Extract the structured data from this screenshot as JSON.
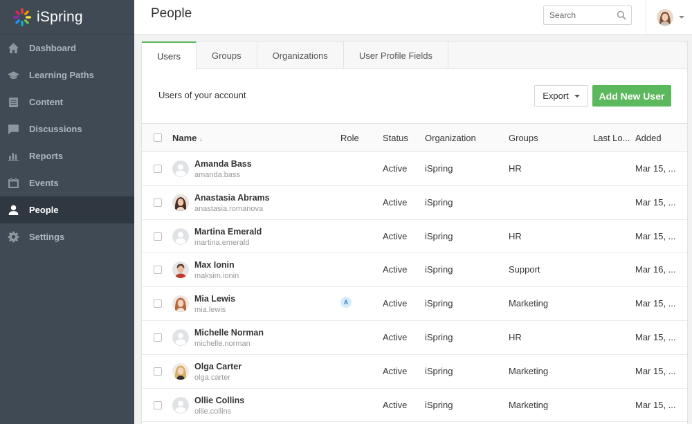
{
  "app": {
    "logo_text": "iSpring"
  },
  "sidebar": {
    "items": [
      {
        "label": "Dashboard",
        "icon": "home-icon",
        "active": false
      },
      {
        "label": "Learning Paths",
        "icon": "graduation-cap-icon",
        "active": false
      },
      {
        "label": "Content",
        "icon": "document-icon",
        "active": false
      },
      {
        "label": "Discussions",
        "icon": "chat-icon",
        "active": false
      },
      {
        "label": "Reports",
        "icon": "bar-chart-icon",
        "active": false
      },
      {
        "label": "Events",
        "icon": "calendar-icon",
        "active": false
      },
      {
        "label": "People",
        "icon": "person-icon",
        "active": true
      },
      {
        "label": "Settings",
        "icon": "gear-icon",
        "active": false
      }
    ]
  },
  "header": {
    "title": "People",
    "search_placeholder": "Search"
  },
  "tabs": [
    {
      "label": "Users",
      "active": true
    },
    {
      "label": "Groups",
      "active": false
    },
    {
      "label": "Organizations",
      "active": false
    },
    {
      "label": "User Profile Fields",
      "active": false
    }
  ],
  "toolbar": {
    "subtitle": "Users of your account",
    "export_label": "Export",
    "add_label": "Add New User"
  },
  "table": {
    "columns": {
      "name": "Name",
      "sort_icon": "↓",
      "role": "Role",
      "status": "Status",
      "organization": "Organization",
      "groups": "Groups",
      "last_login": "Last Lo...",
      "added": "Added"
    },
    "rows": [
      {
        "name": "Amanda Bass",
        "login": "amanda.bass",
        "role": "",
        "status": "Active",
        "organization": "iSpring",
        "groups": "HR",
        "last_login": "",
        "added": "Mar 15, ...",
        "avatar": "placeholder"
      },
      {
        "name": "Anastasia Abrams",
        "login": "anastasia.romanova",
        "role": "",
        "status": "Active",
        "organization": "iSpring",
        "groups": "",
        "last_login": "",
        "added": "Mar 15, ...",
        "avatar": "photo-brunette"
      },
      {
        "name": "Martina Emerald",
        "login": "martina.emerald",
        "role": "",
        "status": "Active",
        "organization": "iSpring",
        "groups": "HR",
        "last_login": "",
        "added": "Mar 15, ...",
        "avatar": "placeholder"
      },
      {
        "name": "Max Ionin",
        "login": "maksim.ionin",
        "role": "",
        "status": "Active",
        "organization": "iSpring",
        "groups": "Support",
        "last_login": "",
        "added": "Mar 16, ...",
        "avatar": "photo-man"
      },
      {
        "name": "Mia Lewis",
        "login": "mia.lewis",
        "role": "A",
        "status": "Active",
        "organization": "iSpring",
        "groups": "Marketing",
        "last_login": "",
        "added": "Mar 15, ...",
        "avatar": "photo-redhead"
      },
      {
        "name": "Michelle Norman",
        "login": "michelle.norman",
        "role": "",
        "status": "Active",
        "organization": "iSpring",
        "groups": "HR",
        "last_login": "",
        "added": "Mar 15, ...",
        "avatar": "placeholder"
      },
      {
        "name": "Olga Carter",
        "login": "olga.carter",
        "role": "",
        "status": "Active",
        "organization": "iSpring",
        "groups": "Marketing",
        "last_login": "",
        "added": "Mar 15, ...",
        "avatar": "photo-blonde"
      },
      {
        "name": "Ollie Collins",
        "login": "ollie.collins",
        "role": "",
        "status": "Active",
        "organization": "iSpring",
        "groups": "Marketing",
        "last_login": "",
        "added": "Mar 15, ...",
        "avatar": "placeholder"
      }
    ]
  },
  "colors": {
    "accent": "#5cb85c",
    "sidebar": "#3f4a54",
    "sidebar_active": "#2f3840"
  }
}
